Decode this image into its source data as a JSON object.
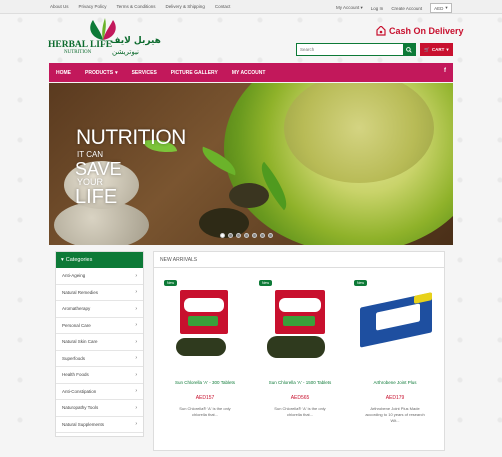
{
  "topbar": {
    "links": [
      "About Us",
      "Privacy Policy",
      "Terms & Conditions",
      "Delivery & Shipping",
      "Contact"
    ],
    "my_account": "My Account",
    "login": "Log In",
    "create_account": "Create Account",
    "currency": "AED"
  },
  "header": {
    "logo_en": "HERBAL LIFE",
    "logo_sub": "NUTRITION",
    "logo_ar": "هيربل لايف",
    "logo_ar2": "نيوتريشن",
    "cod": "Cash On Delivery",
    "search_placeholder": "Search",
    "cart": "CART"
  },
  "nav": {
    "items": [
      "HOME",
      "PRODUCTS",
      "SERVICES",
      "PICTURE GALLERY",
      "MY ACCOUNT"
    ],
    "social": "f"
  },
  "hero": {
    "line1": "NUTRITION",
    "line2": "IT CAN",
    "line3": "SAVE",
    "line4": "YOUR",
    "line5": "LIFE",
    "slides": 7,
    "active_slide": 1
  },
  "categories": {
    "title": "Categories",
    "items": [
      "Anti-Ageing",
      "Natural Remedies",
      "Aromatherapy",
      "Personal Care",
      "Natural Skin Care",
      "Superfoods",
      "Health Foods",
      "Anti-Constipation",
      "Naturopathy Tools",
      "Natural Supplements"
    ]
  },
  "new_arrivals": {
    "title": "NEW ARRIVALS",
    "badge": "New",
    "products": [
      {
        "name": "Sun Chlorella 'A' - 300 Tablets",
        "price": "AED157",
        "desc1": "Sun Chlorella® 'A' is the only",
        "desc2": "chlorella that..."
      },
      {
        "name": "Sun Chlorella 'A' - 1500 Tablets",
        "price": "AED565",
        "desc1": "Sun Chlorella® 'A' is the only",
        "desc2": "chlorella that..."
      },
      {
        "name": "Arthrobene Joint Plus",
        "price": "AED179",
        "desc1": "Arthrobene Joint Plus Made",
        "desc2": "according to 10 years of research",
        "desc3": "Wit..."
      }
    ]
  }
}
